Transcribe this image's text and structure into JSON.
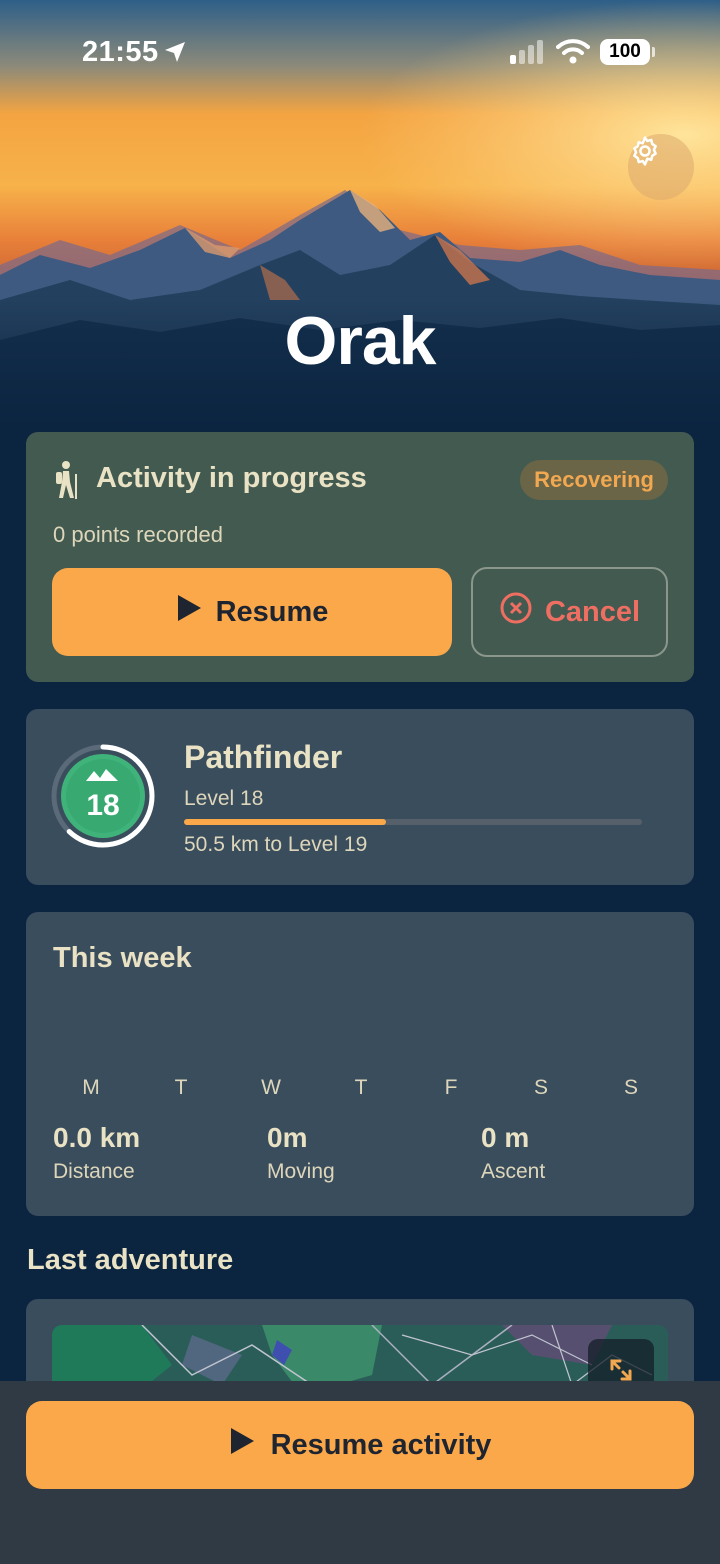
{
  "status_bar": {
    "time": "21:55",
    "battery": "100"
  },
  "hero": {
    "logo": "Orak"
  },
  "activity": {
    "title": "Activity in progress",
    "badge": "Recovering",
    "points": "0 points recorded",
    "resume_label": "Resume",
    "cancel_label": "Cancel"
  },
  "level": {
    "title": "Pathfinder",
    "badge_number": "18",
    "level_label": "Level 18",
    "progress": 0.44,
    "ring_progress": 0.62,
    "remaining": "50.5 km to Level 19"
  },
  "week": {
    "title": "This week",
    "days": [
      "M",
      "T",
      "W",
      "T",
      "F",
      "S",
      "S"
    ],
    "stats": [
      {
        "value": "0.0 km",
        "label": "Distance"
      },
      {
        "value": "0m",
        "label": "Moving"
      },
      {
        "value": "0 m",
        "label": "Ascent"
      }
    ]
  },
  "last_adventure": {
    "title": "Last adventure"
  },
  "bottom": {
    "resume_activity_label": "Resume activity"
  },
  "colors": {
    "accent": "#fba84a",
    "danger": "#ee6e62",
    "card": "#3a4d5d",
    "activity_card": "#435a50",
    "level_green": "#3fb37a"
  }
}
